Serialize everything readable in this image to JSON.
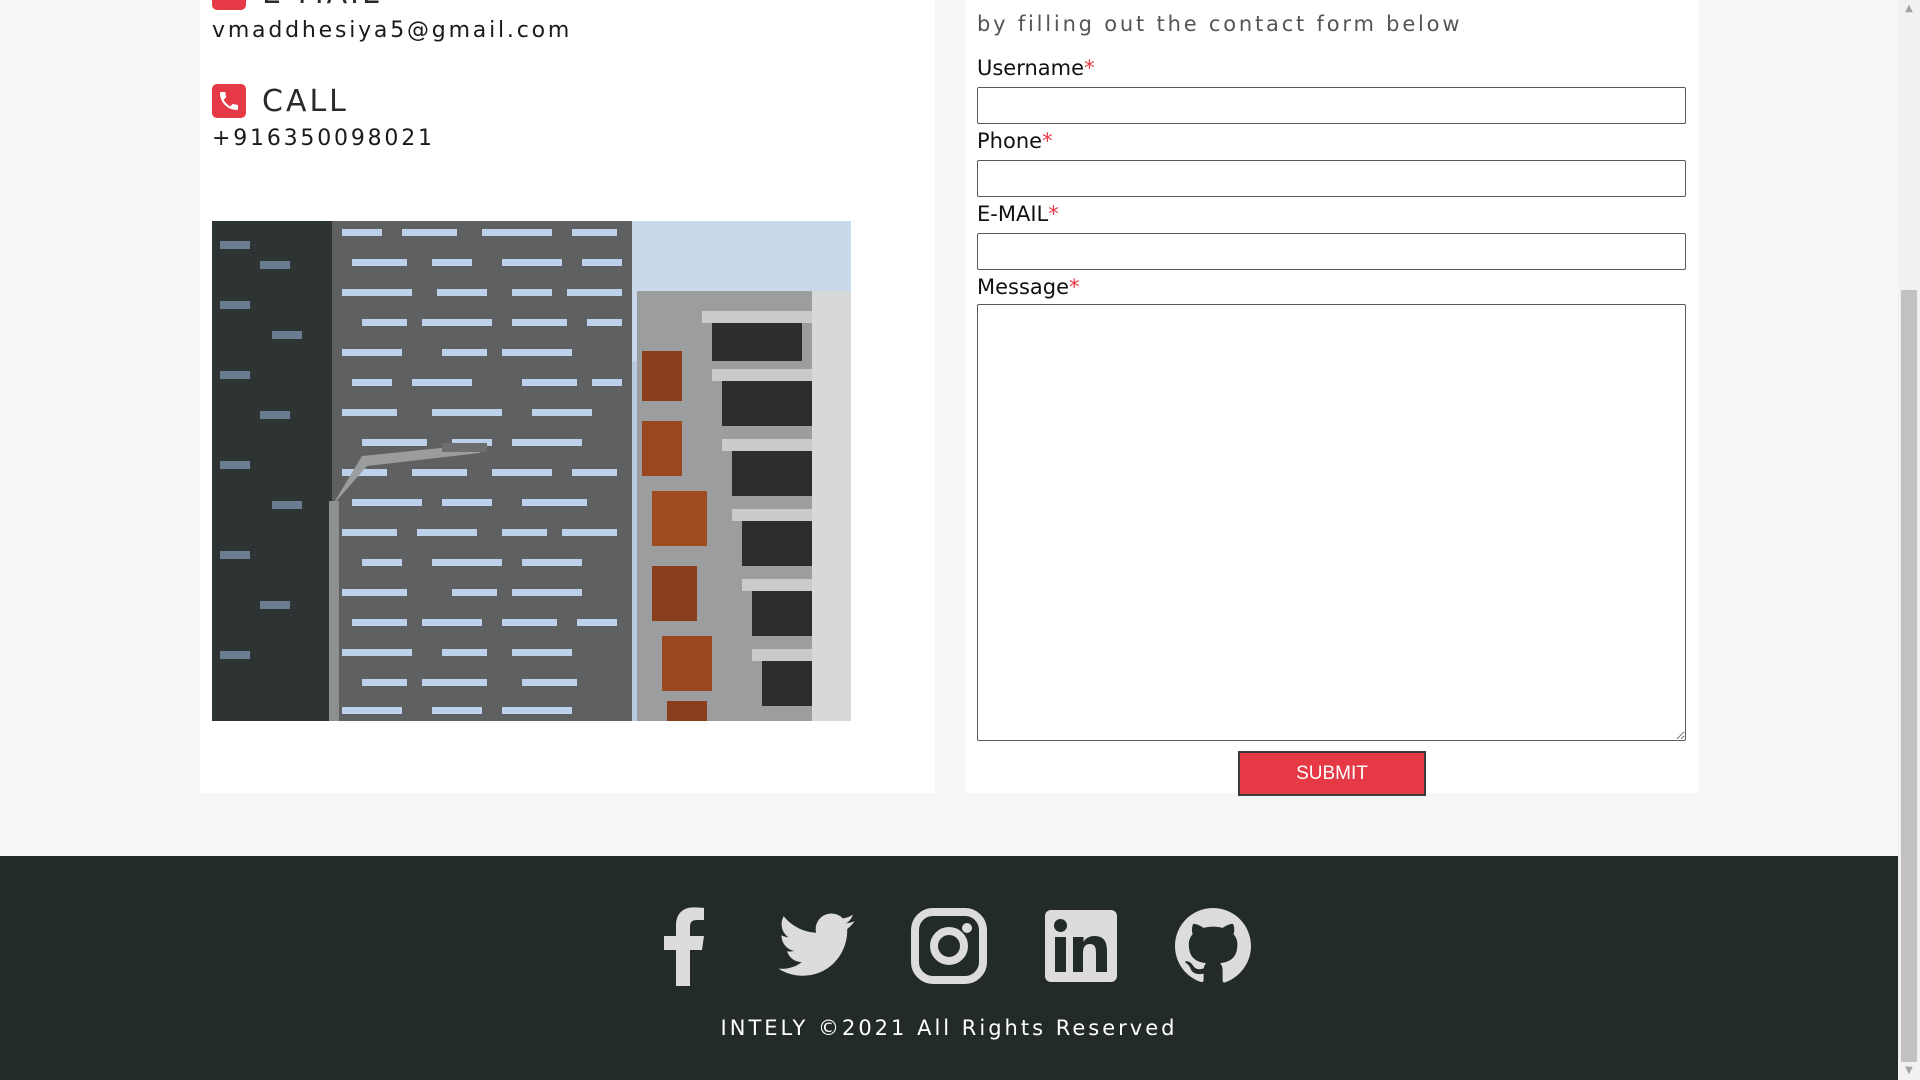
{
  "contact": {
    "email_title": "E-MAIL",
    "email_value": "vmaddhesiya5@gmail.com",
    "call_title": "CALL",
    "call_value": "+916350098021"
  },
  "form": {
    "intro": "by filling out the contact form below",
    "username_label": "Username",
    "phone_label": "Phone",
    "email_label": "E-MAIL",
    "message_label": "Message",
    "required_mark": "*",
    "submit_label": "SUBMIT"
  },
  "footer": {
    "social_icons": [
      "facebook-icon",
      "twitter-icon",
      "instagram-icon",
      "linkedin-icon",
      "github-icon"
    ],
    "copyright": "INTELY ©2021 All Rights Reserved"
  },
  "colors": {
    "accent": "#e63946",
    "footer_bg": "#232b27",
    "page_bg": "#f7f7f7"
  }
}
